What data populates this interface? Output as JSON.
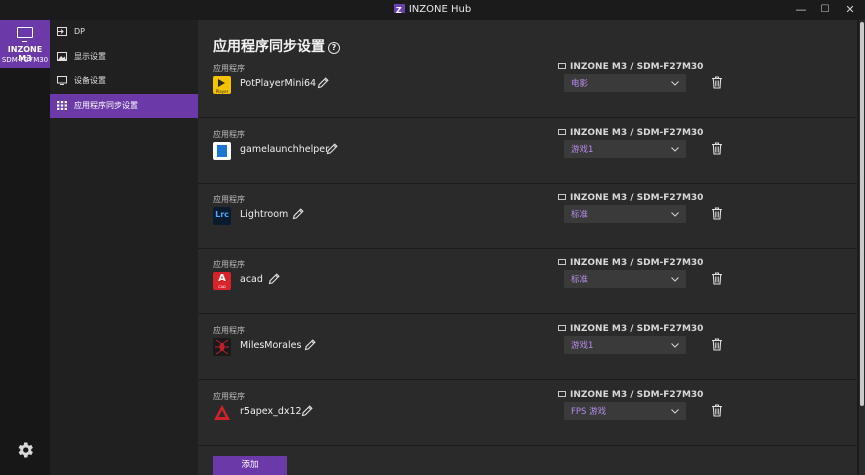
{
  "window": {
    "title": "INZONE Hub",
    "minimize_label": "—",
    "maximize_label": "☐",
    "close_label": "✕"
  },
  "device": {
    "name": "INZONE M3",
    "model": "SDM-F27M30"
  },
  "sidebar": {
    "items": [
      {
        "label": "DP",
        "icon": "input-icon"
      },
      {
        "label": "显示设置",
        "icon": "image-icon"
      },
      {
        "label": "设备设置",
        "icon": "monitor-icon"
      },
      {
        "label": "应用程序同步设置",
        "icon": "grid-icon",
        "active": true
      }
    ]
  },
  "main": {
    "title": "应用程序同步设置",
    "help_label": "?",
    "add_label": "添加",
    "rows": [
      {
        "section_label": "应用程序",
        "app": "PotPlayerMini64",
        "device": "INZONE M3 / SDM-F27M30",
        "mode": "电影"
      },
      {
        "section_label": "应用程序",
        "app": "gamelaunchhelper",
        "device": "INZONE M3 / SDM-F27M30",
        "mode": "游戏1"
      },
      {
        "section_label": "应用程序",
        "app": "Lightroom",
        "device": "INZONE M3 / SDM-F27M30",
        "mode": "标准"
      },
      {
        "section_label": "应用程序",
        "app": "acad",
        "device": "INZONE M3 / SDM-F27M30",
        "mode": "标准"
      },
      {
        "section_label": "应用程序",
        "app": "MilesMorales",
        "device": "INZONE M3 / SDM-F27M30",
        "mode": "游戏1"
      },
      {
        "section_label": "应用程序",
        "app": "r5apex_dx12",
        "device": "INZONE M3 / SDM-F27M30",
        "mode": "FPS 游戏"
      }
    ],
    "app_icon_text": {
      "lightroom": "Lrc",
      "acad": "A",
      "acad_sub": "CAD",
      "potplayer": "Player"
    }
  },
  "colors": {
    "accent": "#6b3aa8",
    "select_text": "#b58be8",
    "background": "#2a2a2a"
  }
}
